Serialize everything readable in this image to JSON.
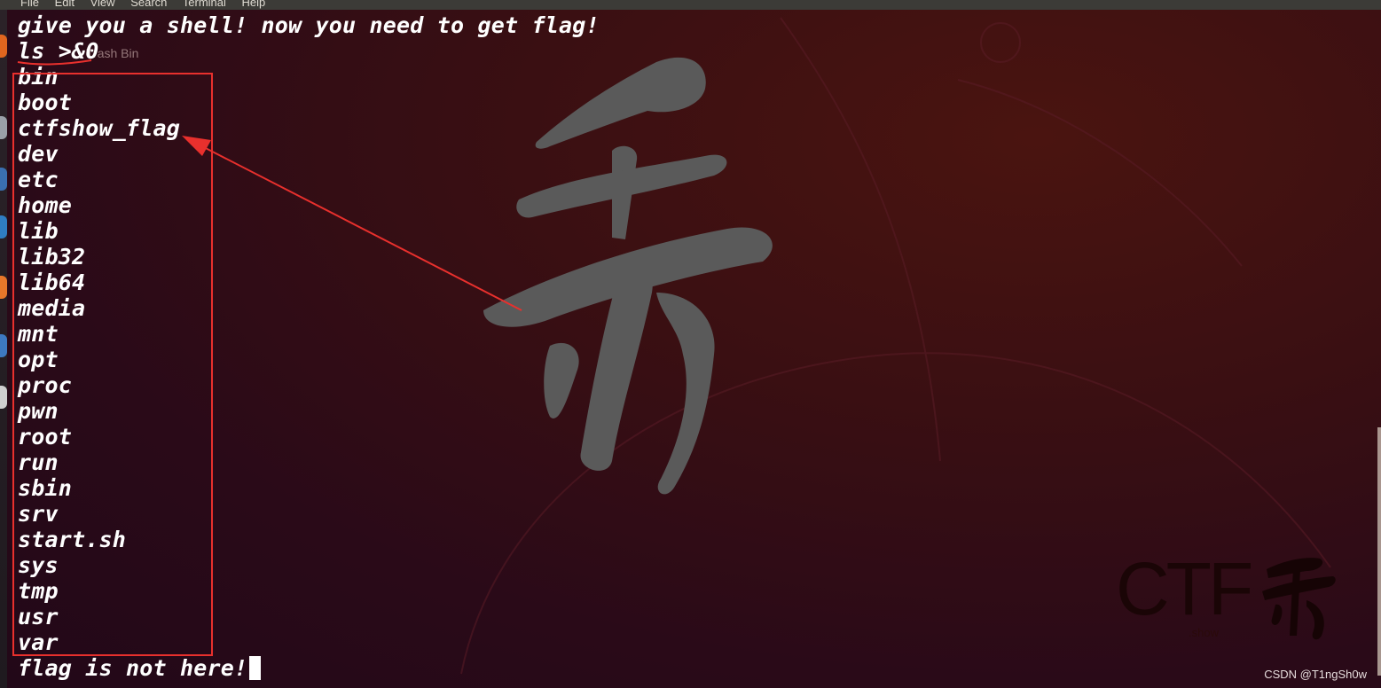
{
  "menu": [
    "File",
    "Edit",
    "View",
    "Search",
    "Terminal",
    "Help"
  ],
  "terminal": {
    "header": "give you a shell! now you need to get flag!",
    "command": "ls >&0",
    "listing": [
      "bin",
      "boot",
      "ctfshow_flag",
      "dev",
      "etc",
      "home",
      "lib",
      "lib32",
      "lib64",
      "media",
      "mnt",
      "opt",
      "proc",
      "pwn",
      "root",
      "run",
      "sbin",
      "srv",
      "start.sh",
      "sys",
      "tmp",
      "usr",
      "var"
    ],
    "last_line": "flag is not here!"
  },
  "ghost_text": "Trash Bin",
  "logo": {
    "text": "CTF",
    "sub": ".show",
    "glyph": "秀"
  },
  "watermark": "CSDN @T1ngSh0w",
  "colors": {
    "annotation": "#e8302d",
    "brush": "#5a5a5a"
  }
}
